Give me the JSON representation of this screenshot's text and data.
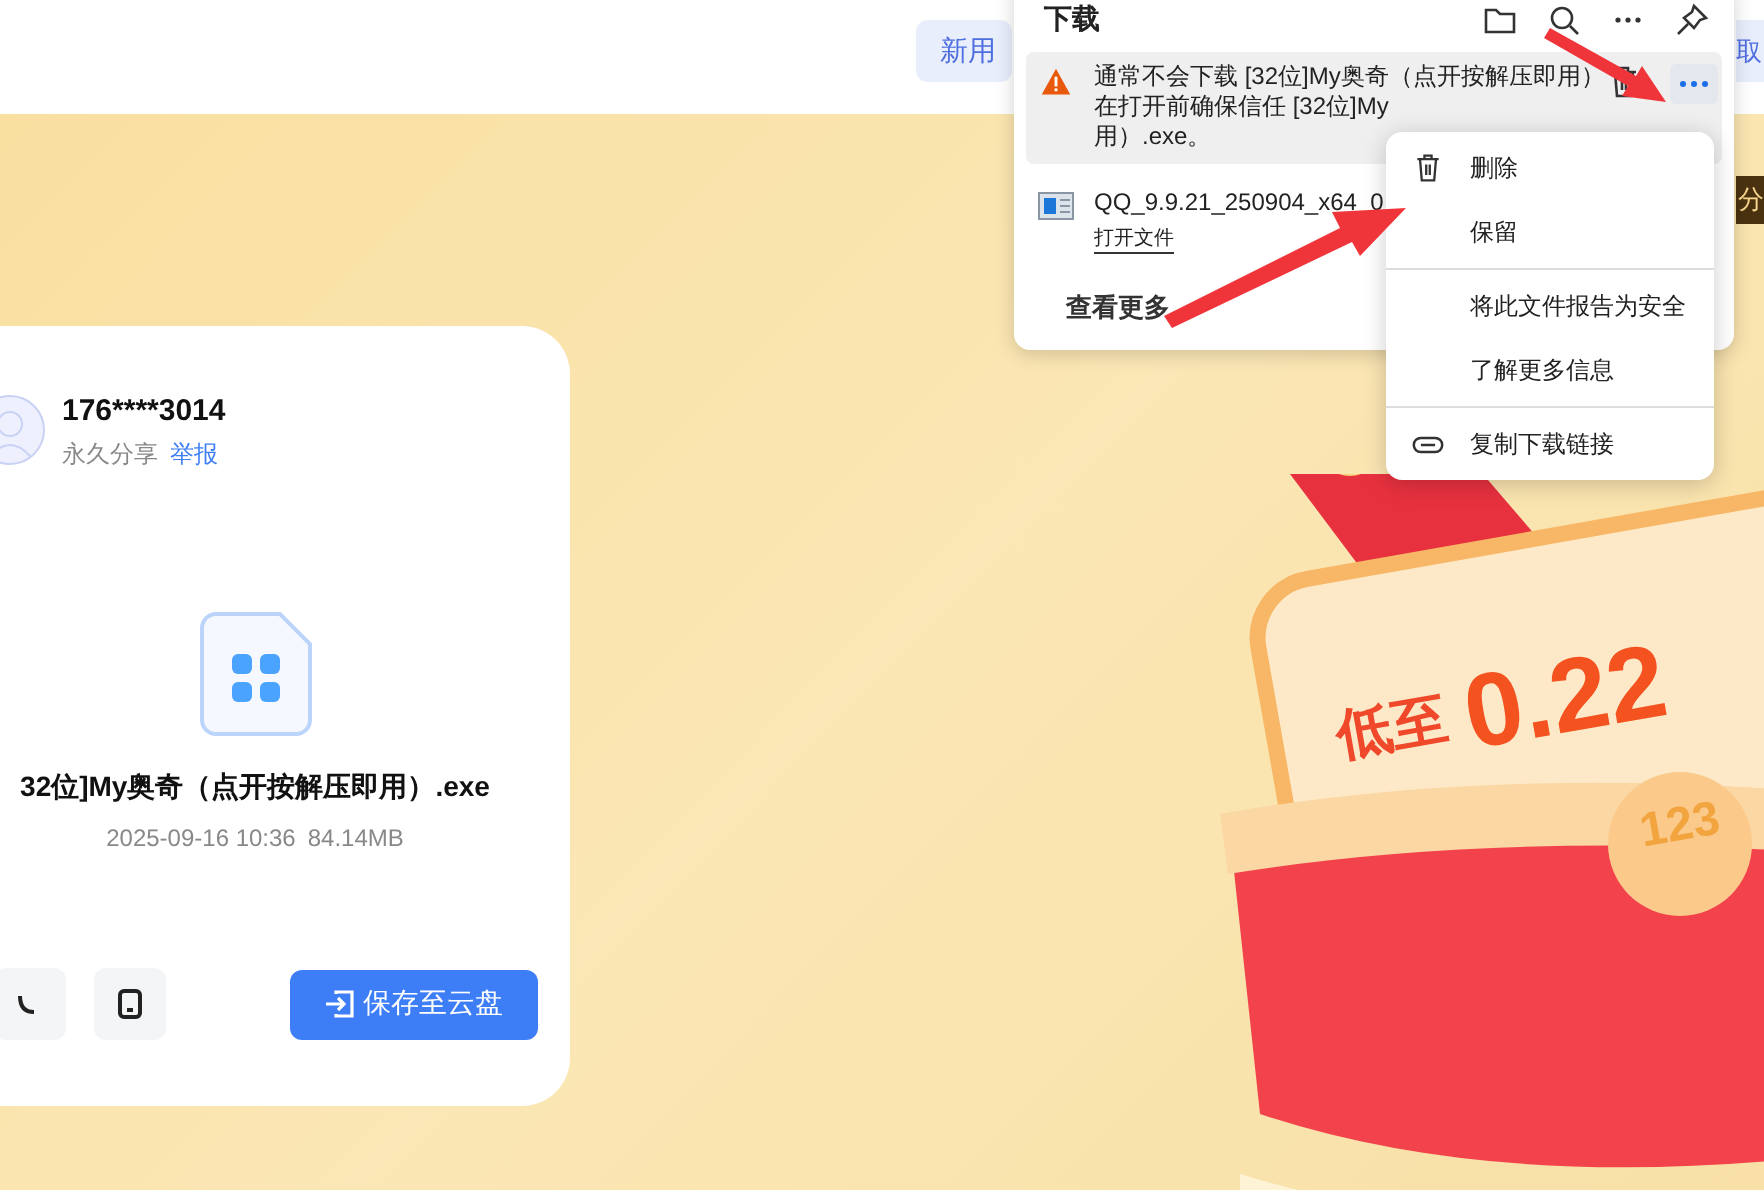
{
  "header": {
    "promo_button": "新用",
    "right_button": "取"
  },
  "share_card": {
    "user": "176****3014",
    "share_type": "永久分享",
    "report_link": "举报",
    "file_name": "32位]My奥奇（点开按解压即用）.exe",
    "file_date": "2025-09-16 10:36",
    "file_size": "84.14MB",
    "save_button": "保存至云盘"
  },
  "banner": {
    "tag": "分",
    "slogan": "低至",
    "price": "0.22",
    "coin": "123"
  },
  "downloads_panel": {
    "title": "下载",
    "items": [
      {
        "kind": "warning",
        "selected": true,
        "lines": [
          "通常不会下载 [32位]My奥奇（点开按解压即用）",
          "在打开前确保信任 [32位]My",
          "用）.exe。"
        ]
      },
      {
        "kind": "file",
        "selected": false,
        "name": "QQ_9.9.21_250904_x64_0",
        "action": "打开文件"
      }
    ],
    "more": "查看更多"
  },
  "context_menu": {
    "items": [
      {
        "kind": "delete",
        "label": "删除",
        "divider_before": false
      },
      {
        "kind": "plain",
        "label": "保留",
        "divider_before": false
      },
      {
        "kind": "plain",
        "label": "将此文件报告为安全",
        "divider_before": true
      },
      {
        "kind": "plain",
        "label": "了解更多信息",
        "divider_before": false
      },
      {
        "kind": "link",
        "label": "复制下载链接",
        "divider_before": true
      }
    ]
  }
}
